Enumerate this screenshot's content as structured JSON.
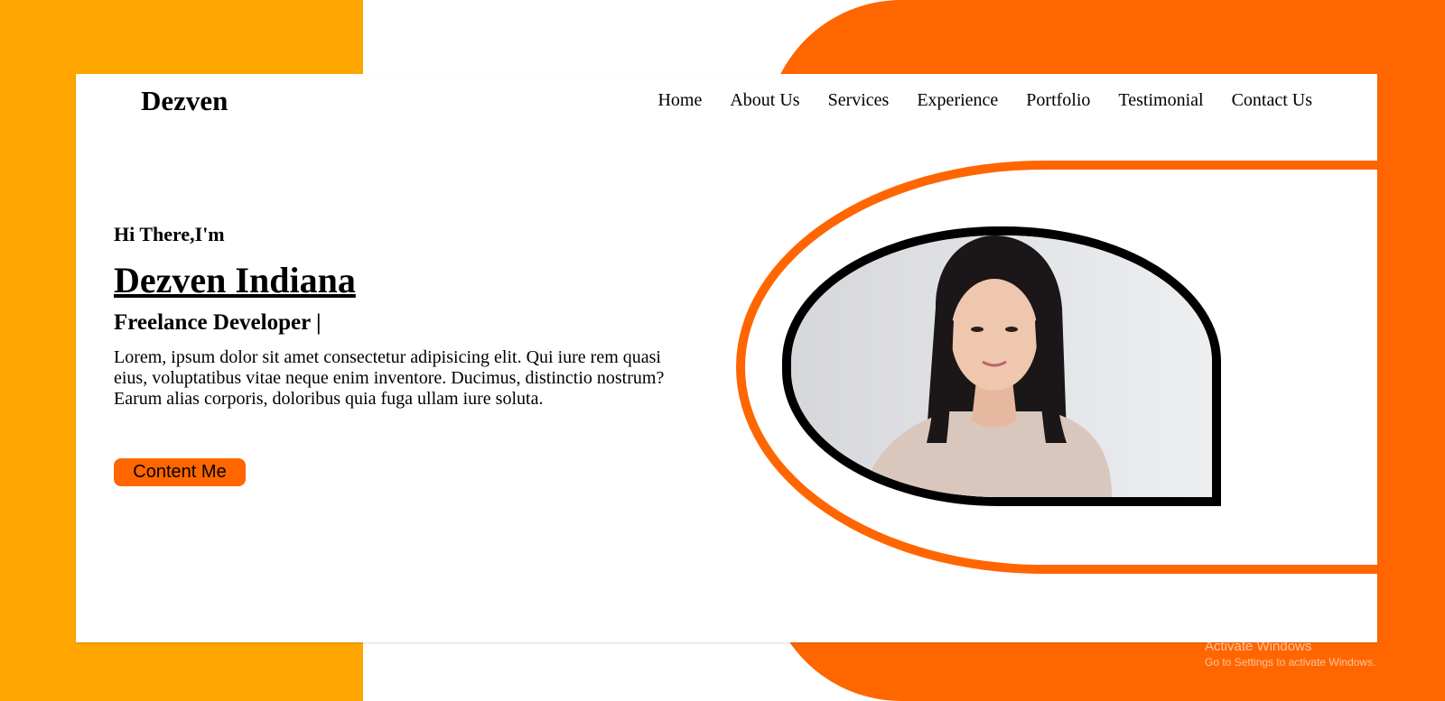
{
  "brand": {
    "logo": "Dezven"
  },
  "nav": {
    "items": [
      {
        "label": "Home"
      },
      {
        "label": "About Us"
      },
      {
        "label": "Services"
      },
      {
        "label": "Experience"
      },
      {
        "label": "Portfolio"
      },
      {
        "label": "Testimonial"
      },
      {
        "label": "Contact Us"
      }
    ]
  },
  "hero": {
    "greeting": "Hi There,I'm",
    "name": "Dezven Indiana",
    "role": "Freelance Developer |",
    "description": "Lorem, ipsum dolor sit amet consectetur adipisicing elit. Qui iure rem quasi eius, voluptatibus vitae neque enim inventore. Ducimus, distinctio nostrum? Earum alias corporis, doloribus quia fuga ullam iure soluta.",
    "cta_label": "Content Me"
  },
  "watermark": {
    "title": "Activate Windows",
    "subtitle": "Go to Settings to activate Windows."
  },
  "colors": {
    "accent_orange": "#FF6600",
    "side_orange": "#FFA500",
    "frame_black": "#000000"
  },
  "icons": {
    "portrait": "portrait-photo"
  }
}
